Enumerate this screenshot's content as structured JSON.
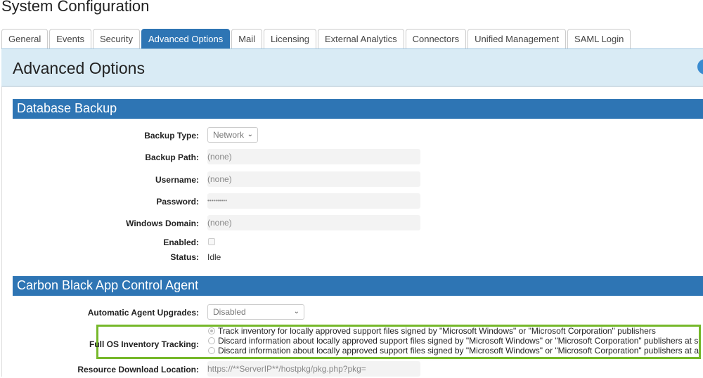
{
  "page_title": "System Configuration",
  "tabs": [
    {
      "label": "General"
    },
    {
      "label": "Events"
    },
    {
      "label": "Security"
    },
    {
      "label": "Advanced Options",
      "active": true
    },
    {
      "label": "Mail"
    },
    {
      "label": "Licensing"
    },
    {
      "label": "External Analytics"
    },
    {
      "label": "Connectors"
    },
    {
      "label": "Unified Management"
    },
    {
      "label": "SAML Login"
    }
  ],
  "header": {
    "title": "Advanced Options"
  },
  "database_backup": {
    "title": "Database Backup",
    "backup_type": {
      "label": "Backup Type:",
      "value": "Network"
    },
    "backup_path": {
      "label": "Backup Path:",
      "value": "(none)"
    },
    "username": {
      "label": "Username:",
      "value": "(none)"
    },
    "password": {
      "label": "Password:",
      "value": "••••••••••"
    },
    "windows_domain": {
      "label": "Windows Domain:",
      "value": "(none)"
    },
    "enabled": {
      "label": "Enabled:",
      "checked": false
    },
    "status": {
      "label": "Status:",
      "value": "Idle"
    }
  },
  "agent": {
    "title": "Carbon Black App Control Agent",
    "upgrades": {
      "label": "Automatic Agent Upgrades:",
      "value": "Disabled"
    },
    "inventory": {
      "label": "Full OS Inventory Tracking:",
      "options": [
        {
          "label": "Track inventory for locally approved support files signed by \"Microsoft Windows\" or \"Microsoft Corporation\" publishers",
          "selected": true
        },
        {
          "label": "Discard information about locally approved support files signed by \"Microsoft Windows\" or \"Microsoft Corporation\" publishers at serve",
          "selected": false
        },
        {
          "label": "Discard information about locally approved support files signed by \"Microsoft Windows\" or \"Microsoft Corporation\" publishers at agent",
          "selected": false
        }
      ]
    },
    "resource": {
      "label": "Resource Download Location:",
      "value": "https://**ServerIP**/hostpkg/pkg.php?pkg="
    }
  },
  "colors": {
    "accent": "#2e75b4",
    "header_band": "#d9ebf5",
    "highlight": "#76b82a"
  }
}
